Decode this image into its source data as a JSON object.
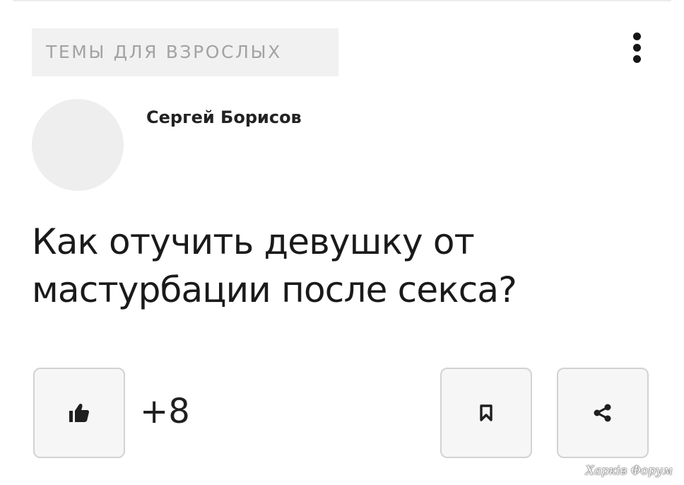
{
  "post": {
    "category": "ТЕМЫ ДЛЯ ВЗРОСЛЫХ",
    "author": "Сергей Борисов",
    "title": "Как отучить девушку от мастурбации после секса?",
    "likes": "+8"
  },
  "icons": {
    "more": "vertical-dots-icon",
    "like": "thumbs-up-icon",
    "bookmark": "bookmark-icon",
    "share": "share-icon"
  },
  "watermark": "Харків Форум"
}
